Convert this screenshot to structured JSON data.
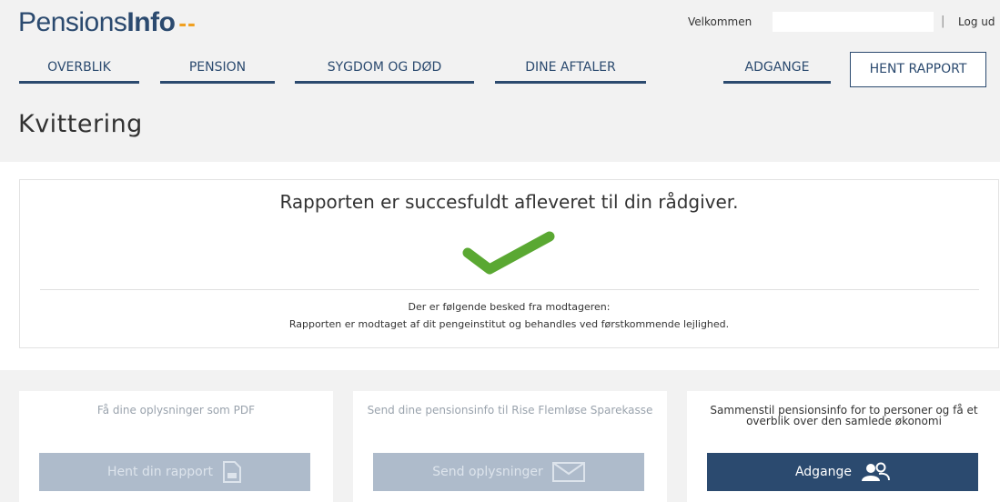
{
  "header": {
    "logo_prefix": "Pensions",
    "logo_bold": "Info",
    "logo_dots": "--",
    "welcome": "Velkommen",
    "separator": "|",
    "logout": "Log ud"
  },
  "nav": {
    "items": [
      "OVERBLIK",
      "PENSION",
      "SYGDOM OG DØD",
      "DINE AFTALER",
      "ADGANGE"
    ],
    "report_button": "HENT RAPPORT"
  },
  "page": {
    "title": "Kvittering"
  },
  "receipt": {
    "headline": "Rapporten er succesfuldt afleveret til din rådgiver.",
    "message_intro": "Der er følgende besked fra modtageren:",
    "message_body": "Rapporten er modtaget af dit pengeinstitut og behandles ved førstkommende lejlighed."
  },
  "cards": [
    {
      "text": "Få dine oplysninger som PDF",
      "button": "Hent din rapport",
      "icon": "document-icon",
      "enabled": false
    },
    {
      "text": "Send dine pensionsinfo til Rise Flemløse Sparekasse",
      "button": "Send oplysninger",
      "icon": "envelope-icon",
      "enabled": false
    },
    {
      "text": "Sammenstil pensionsinfo for to personer og få et overblik over den samlede økonomi",
      "button": "Adgange",
      "icon": "people-icon",
      "enabled": true
    }
  ],
  "colors": {
    "brand": "#2b4a6f",
    "accent": "#f0a020",
    "success": "#5aa832",
    "disabled_button": "#aebbcb"
  }
}
